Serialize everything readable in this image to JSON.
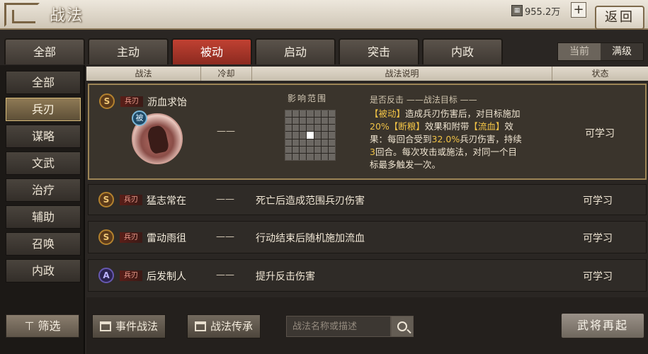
{
  "header": {
    "title": "战法",
    "currency_value": "955.2万",
    "plus_label": "+",
    "back_label": "返回"
  },
  "tabs": [
    {
      "label": "全部"
    },
    {
      "label": "主动"
    },
    {
      "label": "被动"
    },
    {
      "label": "启动"
    },
    {
      "label": "突击"
    },
    {
      "label": "内政"
    }
  ],
  "level_toggle": {
    "current": "当前",
    "max": "满级"
  },
  "sidebar": {
    "items": [
      {
        "label": "全部"
      },
      {
        "label": "兵刃"
      },
      {
        "label": "谋略"
      },
      {
        "label": "文武"
      },
      {
        "label": "治疗"
      },
      {
        "label": "辅助"
      },
      {
        "label": "召唤"
      },
      {
        "label": "内政"
      }
    ],
    "filter_label": "筛选"
  },
  "table": {
    "headers": {
      "skill": "战法",
      "cooldown": "冷却",
      "desc": "战法说明",
      "state": "状态"
    },
    "rows": [
      {
        "grade": "S",
        "tag": "兵刃",
        "name": "沥血求饴",
        "cooldown": "——",
        "state": "可学习",
        "passive_badge": "被",
        "range_label": "影响范围",
        "detail_title": "是否反击 ——战法目标 ——",
        "detail_parts": {
          "p1": "【被动】",
          "p2": "造成兵刃伤害后，对目标施加",
          "p3": "20%",
          "p4": "【断粮】",
          "p5": "效果和附带",
          "p6": "【流血】",
          "p7": "效果：每回合受到",
          "p8": "32.0%",
          "p9": "兵刃伤害，持续",
          "p10": "3",
          "p11": "回合。每次攻击或施法，对同一个目标最多触发一次。"
        }
      },
      {
        "grade": "S",
        "tag": "兵刃",
        "name": "猛志常在",
        "cooldown": "——",
        "desc": "死亡后造成范围兵刃伤害",
        "state": "可学习"
      },
      {
        "grade": "S",
        "tag": "兵刃",
        "name": "雷动雨徂",
        "cooldown": "——",
        "desc": "行动结束后随机施加流血",
        "state": "可学习"
      },
      {
        "grade": "A",
        "tag": "兵刃",
        "name": "后发制人",
        "cooldown": "——",
        "desc": "提升反击伤害",
        "state": "可学习"
      }
    ]
  },
  "bottom": {
    "event_skills_label": "事件战法",
    "inherit_label": "战法传承",
    "search_placeholder": "战法名称或描述",
    "rebirth_label": "武将再起"
  }
}
